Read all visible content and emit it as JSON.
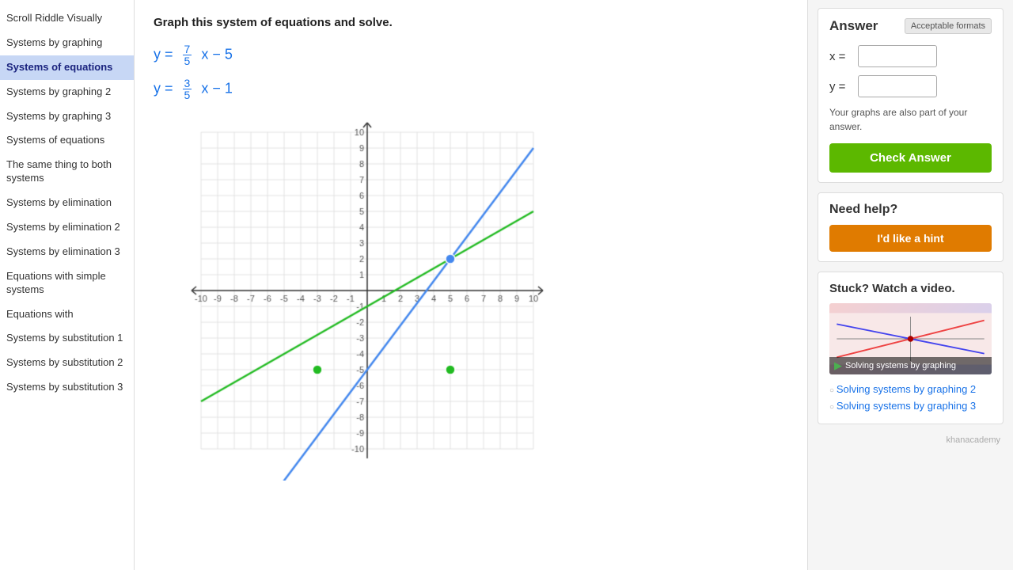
{
  "sidebar": {
    "items": [
      {
        "id": "scroll-riddle",
        "label": "Scroll Riddle Visually",
        "active": false
      },
      {
        "id": "systems-graphing",
        "label": "Systems by graphing",
        "active": false
      },
      {
        "id": "systems-of-equations",
        "label": "Systems of equations",
        "active": true
      },
      {
        "id": "systems-graphing-2",
        "label": "Systems by graphing 2",
        "active": false
      },
      {
        "id": "systems-graphing-3",
        "label": "Systems by graphing 3",
        "active": false
      },
      {
        "id": "systems-of-equations-2",
        "label": "Systems of equations",
        "active": false
      },
      {
        "id": "same-thing-both",
        "label": "The same thing to both systems",
        "active": false
      },
      {
        "id": "systems-elimination",
        "label": "Systems by elimination",
        "active": false
      },
      {
        "id": "systems-elimination-2",
        "label": "Systems by elimination 2",
        "active": false
      },
      {
        "id": "systems-elimination-3",
        "label": "Systems by elimination 3",
        "active": false
      },
      {
        "id": "equations-simple",
        "label": "Equations with simple systems",
        "active": false
      },
      {
        "id": "equations-with",
        "label": "Equations with",
        "active": false
      },
      {
        "id": "systems-substitution-1",
        "label": "Systems by substitution 1",
        "active": false
      },
      {
        "id": "systems-substitution-2",
        "label": "Systems by substitution 2",
        "active": false
      },
      {
        "id": "systems-substitution-3",
        "label": "Systems by substitution 3",
        "active": false
      }
    ]
  },
  "problem": {
    "instruction": "Graph this system of equations and solve.",
    "eq1": {
      "text": "y = 7/5 x − 5",
      "display": "y = \\frac{7}{5}x - 5"
    },
    "eq2": {
      "text": "y = 3/5 x − 1",
      "display": "y = \\frac{3}{5}x - 1"
    }
  },
  "answer": {
    "title": "Answer",
    "acceptable_formats": "Acceptable formats",
    "x_label": "x =",
    "y_label": "y =",
    "x_value": "",
    "y_value": "",
    "note": "Your graphs are also part of your answer.",
    "check_button": "Check Answer"
  },
  "help": {
    "title": "Need help?",
    "hint_button": "I'd like a hint"
  },
  "video": {
    "title": "Stuck? Watch a video.",
    "video_label": "Solving systems by graphing",
    "related": [
      "Solving systems by graphing 2",
      "Solving systems by graphing 3"
    ]
  },
  "khan_label": "khanacademy",
  "top_bar": {
    "buttons": [
      "□",
      "□",
      "□",
      "□",
      "▣",
      "▢"
    ]
  },
  "graph": {
    "x_min": -10,
    "x_max": 10,
    "y_min": -10,
    "y_max": 10,
    "line1": {
      "slope": 1.4,
      "intercept": -5,
      "color": "#4488ee"
    },
    "line2": {
      "slope": 0.6,
      "intercept": -1,
      "color": "#22bb22"
    },
    "points": [
      {
        "x": 5,
        "y": 2,
        "color": "#4488ee"
      },
      {
        "x": -3,
        "y": -5,
        "color": "#22bb22"
      },
      {
        "x": 5,
        "y": -5,
        "color": "#22bb22"
      }
    ]
  }
}
